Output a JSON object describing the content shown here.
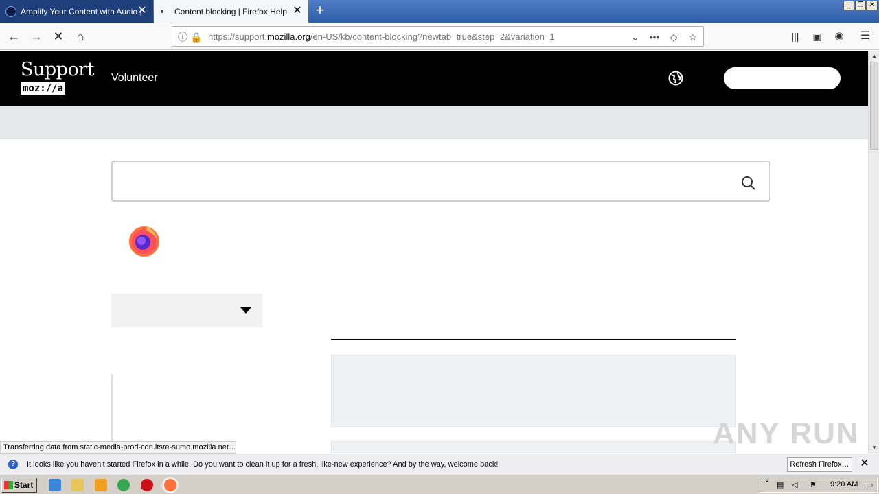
{
  "browser": {
    "tabs": [
      {
        "title": "Amplify Your Content with Audio |",
        "active": false
      },
      {
        "title": "Content blocking | Firefox Help",
        "active": true
      }
    ],
    "url_prefix": "https://support.",
    "url_domain": "mozilla.org",
    "url_suffix": "/en-US/kb/content-blocking?newtab=true&step=2&variation=1"
  },
  "page": {
    "logo_text": "Support",
    "logo_sub": "moz://a",
    "nav_volunteer": "Volunteer",
    "status": "Transferring data from static-media-prod-cdn.itsre-sumo.mozilla.net…",
    "watermark": "ANY RUN"
  },
  "notification": {
    "message": "It looks like you haven’t started Firefox in a while. Do you want to clean it up for a fresh, like-new experience? And by the way, welcome back!",
    "button": "Refresh Firefox…"
  },
  "taskbar": {
    "start_label": "Start",
    "clock": "9:20 AM"
  },
  "colors": {
    "header_bg": "#000000",
    "banner_bg": "#e5e7ea",
    "tabstrip": "#2f5ea8"
  }
}
